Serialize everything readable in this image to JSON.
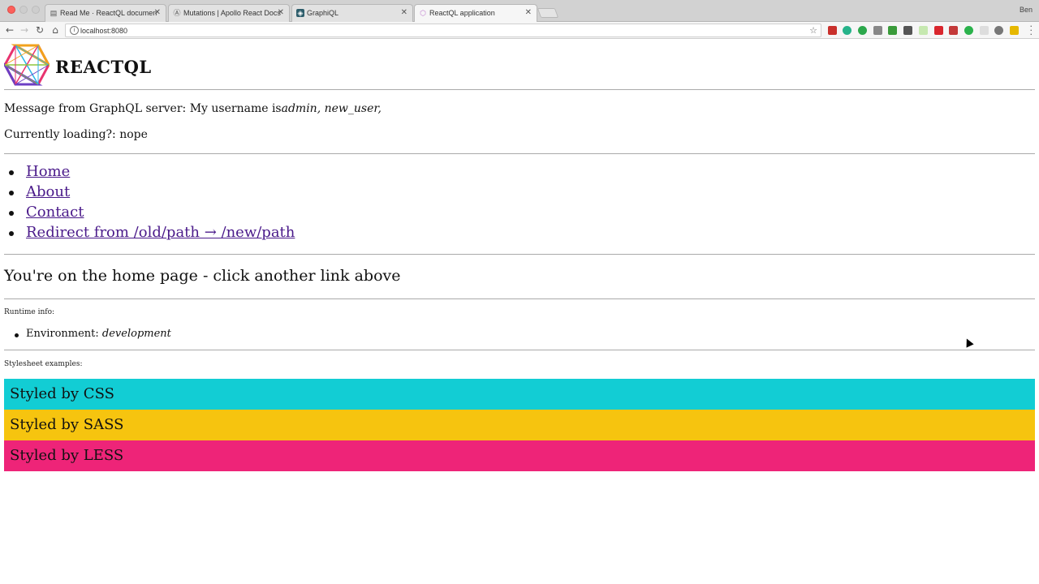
{
  "browser": {
    "tabs": [
      {
        "label": "Read Me · ReactQL documentation",
        "icon": "book-icon"
      },
      {
        "label": "Mutations | Apollo React Docs",
        "icon": "apollo-icon"
      },
      {
        "label": "GraphiQL",
        "icon": "graphiql-icon"
      },
      {
        "label": "ReactQL application",
        "icon": "reactql-icon"
      }
    ],
    "profile_name": "Ben",
    "url": "localhost:8080"
  },
  "page": {
    "brand": "REACTQL",
    "message_prefix": "Message from GraphQL server: My username is",
    "message_value": "admin, new_user,",
    "loading_text": "Currently loading?: nope",
    "nav": [
      {
        "label": "Home"
      },
      {
        "label": "About"
      },
      {
        "label": "Contact"
      },
      {
        "label": "Redirect from /old/path → /new/path"
      }
    ],
    "home_message": "You're on the home page - click another link above",
    "runtime_label": "Runtime info:",
    "env_label": "Environment:",
    "env_value": "development",
    "stylesheet_label": "Stylesheet examples:",
    "styled": [
      {
        "label": "Styled by CSS",
        "color": "#12cdd4"
      },
      {
        "label": "Styled by SASS",
        "color": "#f6c40f"
      },
      {
        "label": "Styled by LESS",
        "color": "#ee2478"
      }
    ]
  }
}
